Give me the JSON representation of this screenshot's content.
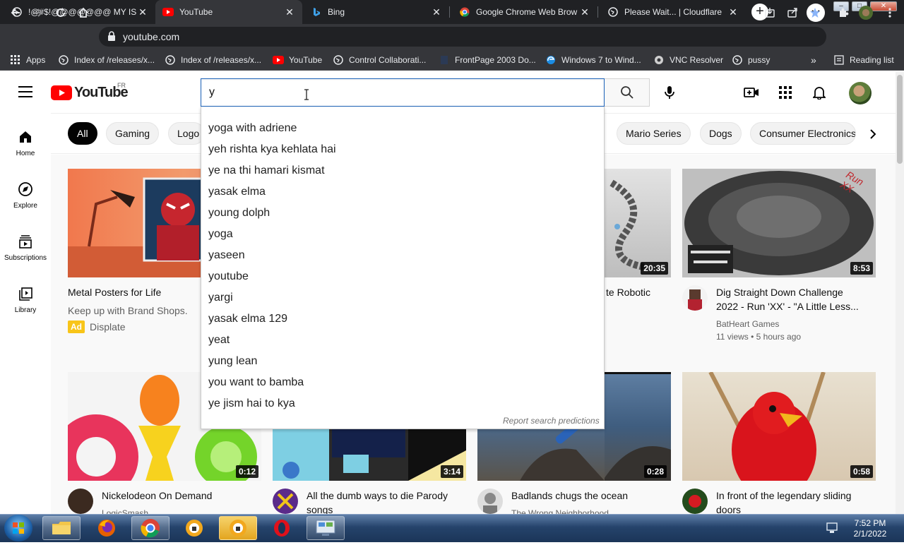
{
  "browser": {
    "tabs": [
      {
        "title": "!@#$!@@@@@@@ MY IS",
        "active": false
      },
      {
        "title": "YouTube",
        "active": true
      },
      {
        "title": "Bing",
        "active": false
      },
      {
        "title": "Google Chrome Web Brow",
        "active": false
      },
      {
        "title": "Please Wait... | Cloudflare",
        "active": false
      }
    ],
    "address": "youtube.com",
    "bookmarks": [
      {
        "label": "Apps",
        "icon": "apps-grid-icon"
      },
      {
        "label": "Index of /releases/x...",
        "icon": "globe-icon"
      },
      {
        "label": "Index of /releases/x...",
        "icon": "globe-icon"
      },
      {
        "label": "YouTube",
        "icon": "youtube-icon"
      },
      {
        "label": "Control Collaborati...",
        "icon": "globe-icon"
      },
      {
        "label": "FrontPage 2003 Do...",
        "icon": "page-icon"
      },
      {
        "label": "Windows 7 to Wind...",
        "icon": "edge-icon"
      },
      {
        "label": "VNC Resolver",
        "icon": "vnc-icon"
      },
      {
        "label": "pussy",
        "icon": "globe-icon"
      }
    ],
    "bookmarks_more": "»",
    "reading_list": "Reading list"
  },
  "youtube": {
    "logo_text": "YouTube",
    "region": "FR",
    "search": {
      "value": "y",
      "suggestions": [
        "yoga with adriene",
        "yeh rishta kya kehlata hai",
        "ye na thi hamari kismat",
        "yasak elma",
        "young dolph",
        "yoga",
        "yaseen",
        "youtube",
        "yargi",
        "yasak elma 129",
        "yeat",
        "yung lean",
        "you want to bamba",
        "ye jism hai to kya"
      ],
      "report": "Report search predictions"
    },
    "guide": [
      {
        "label": "Home",
        "icon": "home-icon"
      },
      {
        "label": "Explore",
        "icon": "compass-icon"
      },
      {
        "label": "Subscriptions",
        "icon": "subscriptions-icon"
      },
      {
        "label": "Library",
        "icon": "library-icon"
      }
    ],
    "chips": [
      "All",
      "Gaming",
      "Logo",
      "Mario Series",
      "Dogs",
      "Consumer Electronics"
    ],
    "videos": [
      {
        "title": "Metal Posters for Life",
        "channel": "Keep up with Brand Shops.",
        "ad_badge": "Ad",
        "advertiser": "Displate"
      },
      {
        "title": "te Robotic",
        "duration": "20:35"
      },
      {
        "title": "Dig Straight Down Challenge 2022 - Run 'XX' - \"A Little Less...",
        "title_line1": "Dig Straight Down Challenge",
        "title_line2": "2022 - Run 'XX' - \"A Little Less...",
        "channel": "BatHeart Games",
        "stats": "11 views • 5 hours ago",
        "duration": "8:53",
        "thumb_text": "Run XX"
      },
      {
        "title": "Nickelodeon On Demand",
        "channel": "LogicSmash",
        "duration": "0:12"
      },
      {
        "title": "All the dumb ways to die Parody songs",
        "title_line1": "All the dumb ways to die Parody",
        "title_line2": "songs",
        "duration": "3:14"
      },
      {
        "title": "Badlands chugs the ocean",
        "channel": "The Wrong Neighborhood",
        "duration": "0:28"
      },
      {
        "title": "In front of the legendary sliding doors",
        "title_line1": "In front of the legendary sliding",
        "title_line2": "doors",
        "duration": "0:58"
      }
    ]
  },
  "taskbar": {
    "time": "7:52 PM",
    "date": "2/1/2022",
    "apps": [
      "explorer-icon",
      "firefox-icon",
      "chrome-icon",
      "vpn-icon",
      "vpn-icon",
      "opera-icon",
      "control-panel-icon"
    ]
  },
  "colors": {
    "youtube_red": "#ff0000",
    "chrome_dark": "#202124",
    "search_focus": "#1c62b9"
  }
}
